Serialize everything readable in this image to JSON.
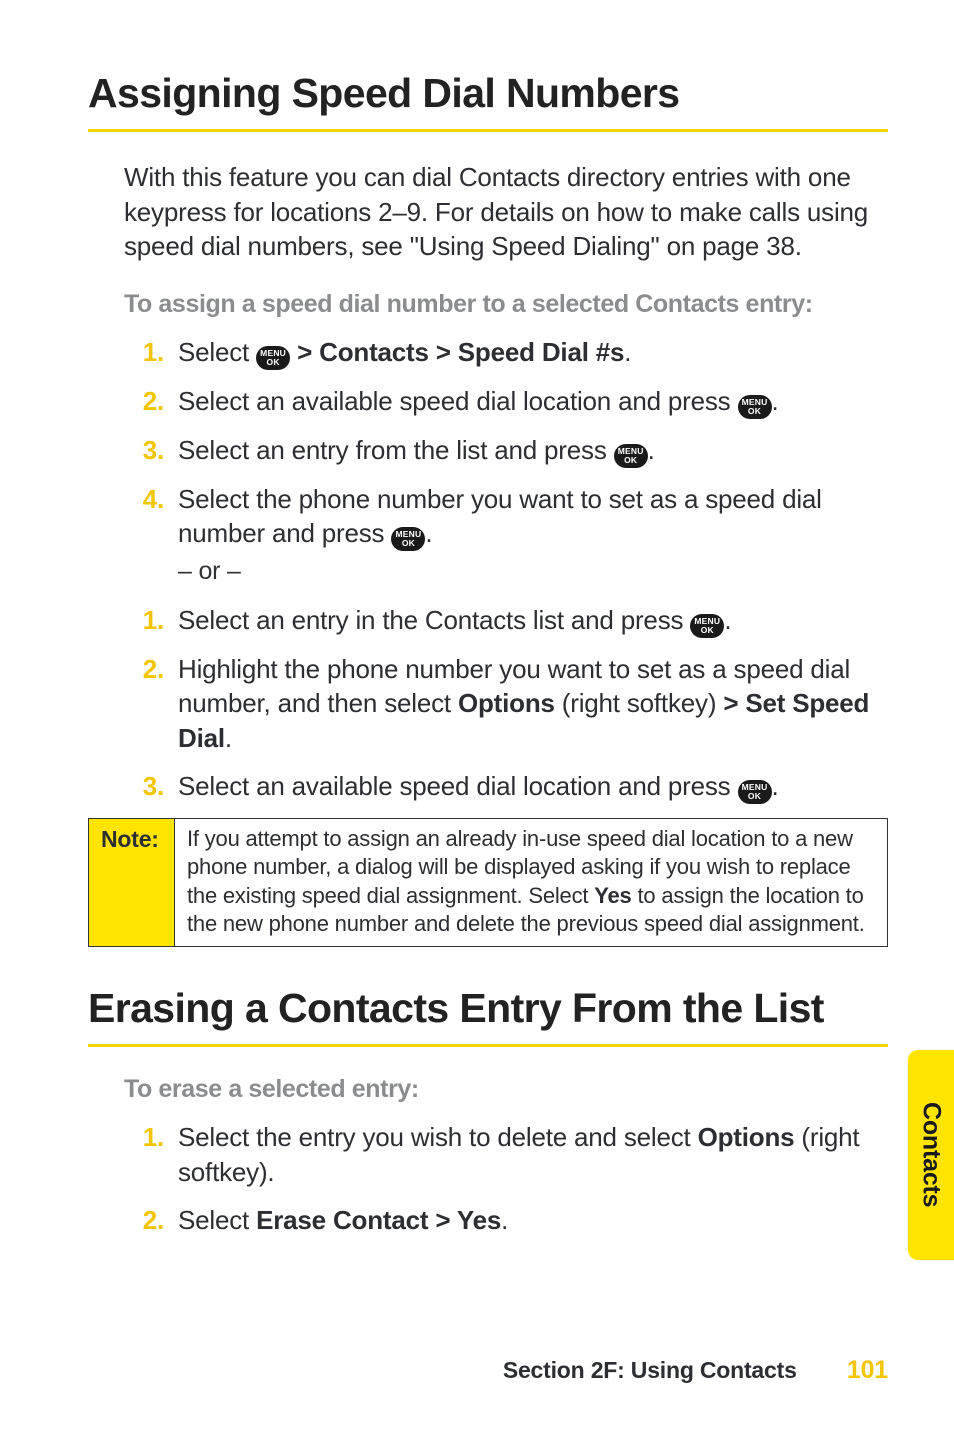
{
  "sections": {
    "speedDial": {
      "title": "Assigning Speed Dial Numbers",
      "intro": "With this feature you can dial Contacts directory entries with one keypress for locations 2–9. For details on how to make calls using speed dial numbers, see \"Using Speed Dialing\" on page 38.",
      "subheading": "To assign a speed dial number to a selected Contacts entry:",
      "listA": {
        "s1_pre": "Select ",
        "s1_post": " > Contacts > Speed Dial #s",
        "s2_pre": "Select an available speed dial location and press ",
        "s3_pre": "Select an entry from the list and press ",
        "s4_pre": "Select the phone number you want to set as a speed dial number and press "
      },
      "or": "– or –",
      "listB": {
        "s1_pre": "Select an entry in the Contacts list and press ",
        "s2_a": "Highlight the phone number you want to set as a speed dial number, and then select ",
        "s2_b": "Options",
        "s2_c": " (right softkey) ",
        "s2_d": "> Set Speed Dial",
        "s3_pre": "Select an available speed dial location and press "
      },
      "note": {
        "label": "Note:",
        "a": "If you attempt to assign an already in-use speed dial location to a new phone number, a dialog will be displayed asking if you wish to replace the existing speed dial assignment. Select ",
        "b": "Yes",
        "c": " to assign the location to the new phone number and delete the previous speed dial assignment."
      }
    },
    "erase": {
      "title": "Erasing a Contacts Entry From the List",
      "subheading": "To erase a selected entry:",
      "list": {
        "s1_a": "Select the entry you wish to delete and select ",
        "s1_b": "Options",
        "s1_c": " (right softkey).",
        "s2_a": "Select ",
        "s2_b": "Erase Contact > Yes"
      }
    }
  },
  "icon": {
    "l1": "MENU",
    "l2": "OK"
  },
  "sideTab": "Contacts",
  "footer": {
    "text": "Section 2F: Using Contacts",
    "page": "101"
  },
  "nums": {
    "n1": "1.",
    "n2": "2.",
    "n3": "3.",
    "n4": "4."
  },
  "punct": {
    "period": ".",
    "periodB": "."
  }
}
